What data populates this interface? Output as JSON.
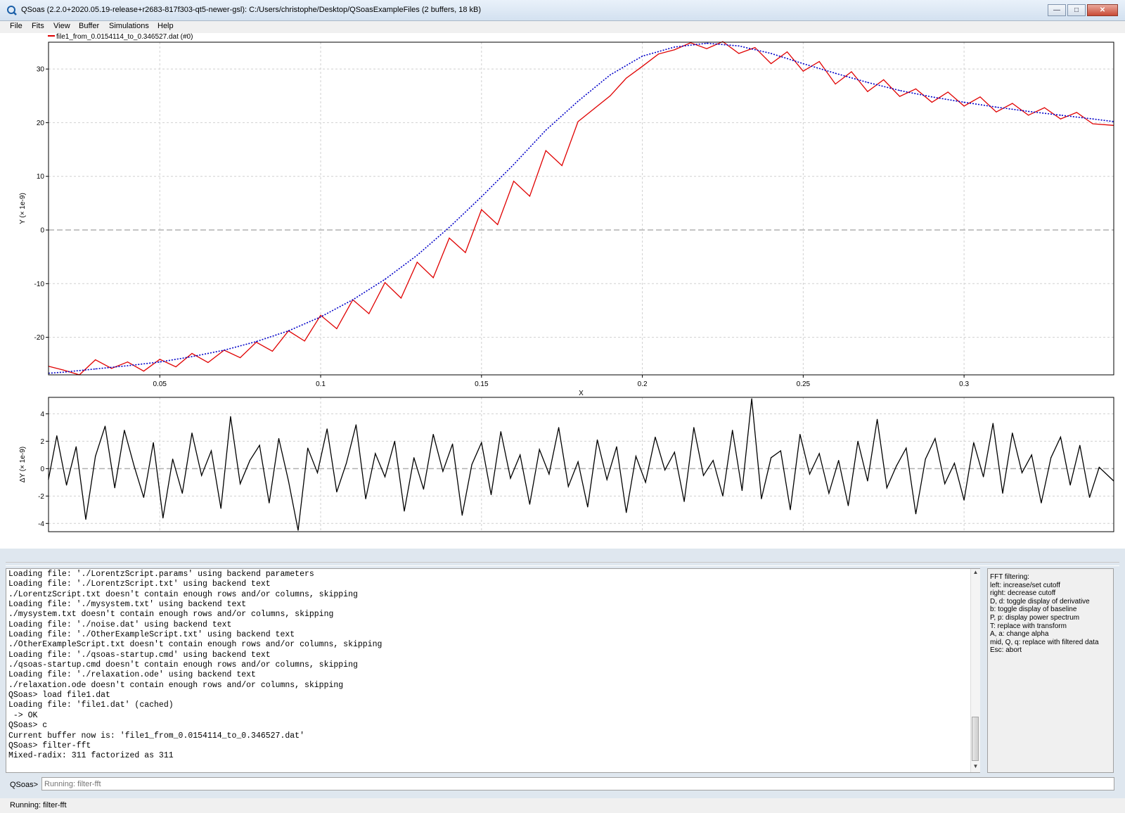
{
  "window": {
    "title": "QSoas (2.2.0+2020.05.19-release+r2683-817f303-qt5-newer-gsl): C:/Users/christophe/Desktop/QSoasExampleFiles (2 buffers, 18 kB)",
    "minimize_glyph": "—",
    "maximize_glyph": "□",
    "close_glyph": "✕"
  },
  "menu": [
    "File",
    "Fits",
    "View",
    "Buffer",
    "Simulations",
    "Help"
  ],
  "legend": {
    "label": "file1_from_0.0154114_to_0.346527.dat (#0)",
    "color": "#e00000"
  },
  "chart_data": [
    {
      "type": "line",
      "xlabel": "X",
      "ylabel": "Y (× 1e-9)",
      "xlim": [
        0.0154114,
        0.346527
      ],
      "ylim": [
        -27,
        35
      ],
      "xticks": [
        0.05,
        0.1,
        0.15,
        0.2,
        0.25,
        0.3
      ],
      "xtick_labels": [
        "0.05",
        "0.1",
        "0.15",
        "0.2",
        "0.25",
        "0.3"
      ],
      "yticks": [
        -20,
        -10,
        0,
        10,
        20,
        30
      ],
      "ytick_labels": [
        "-20",
        "-10",
        "0",
        "10",
        "20",
        "30"
      ],
      "grid": true,
      "series": [
        {
          "name": "file1_from_0.0154114_to_0.346527.dat (#0)",
          "style": "solid",
          "color": "#e00000",
          "x": [
            0.0154,
            0.02,
            0.025,
            0.03,
            0.035,
            0.04,
            0.045,
            0.05,
            0.055,
            0.06,
            0.065,
            0.07,
            0.075,
            0.08,
            0.085,
            0.09,
            0.095,
            0.1,
            0.105,
            0.11,
            0.115,
            0.12,
            0.125,
            0.13,
            0.135,
            0.14,
            0.145,
            0.15,
            0.155,
            0.16,
            0.165,
            0.17,
            0.175,
            0.18,
            0.185,
            0.19,
            0.195,
            0.2,
            0.205,
            0.21,
            0.215,
            0.22,
            0.225,
            0.23,
            0.235,
            0.24,
            0.245,
            0.25,
            0.255,
            0.26,
            0.265,
            0.27,
            0.275,
            0.28,
            0.285,
            0.29,
            0.295,
            0.3,
            0.305,
            0.31,
            0.315,
            0.32,
            0.325,
            0.33,
            0.335,
            0.34,
            0.3465
          ],
          "y": [
            -25.4,
            -26.1,
            -27.0,
            -24.2,
            -25.8,
            -24.6,
            -26.3,
            -24.1,
            -25.5,
            -23.0,
            -24.7,
            -22.4,
            -23.8,
            -20.9,
            -22.6,
            -18.8,
            -20.7,
            -15.9,
            -18.4,
            -13.0,
            -15.6,
            -9.8,
            -12.7,
            -6.0,
            -8.9,
            -1.5,
            -4.2,
            3.8,
            1.0,
            9.1,
            6.3,
            14.8,
            12.0,
            20.2,
            22.6,
            25.0,
            28.3,
            30.5,
            32.8,
            33.6,
            34.9,
            33.8,
            35.1,
            32.9,
            34.0,
            31.0,
            33.2,
            29.6,
            31.4,
            27.2,
            29.5,
            25.8,
            28.0,
            24.9,
            26.3,
            23.8,
            25.7,
            23.1,
            24.8,
            22.0,
            23.6,
            21.4,
            22.8,
            20.7,
            21.9,
            19.8,
            19.5
          ]
        },
        {
          "name": "fit",
          "style": "dotted",
          "color": "#0000c8",
          "x": [
            0.0154,
            0.02,
            0.03,
            0.04,
            0.05,
            0.06,
            0.07,
            0.08,
            0.09,
            0.1,
            0.11,
            0.12,
            0.13,
            0.14,
            0.15,
            0.16,
            0.17,
            0.18,
            0.19,
            0.2,
            0.21,
            0.22,
            0.23,
            0.24,
            0.25,
            0.26,
            0.27,
            0.28,
            0.29,
            0.3,
            0.31,
            0.32,
            0.33,
            0.34,
            0.3465
          ],
          "y": [
            -26.7,
            -26.5,
            -25.9,
            -25.3,
            -24.6,
            -23.6,
            -22.4,
            -20.8,
            -18.8,
            -16.2,
            -13.0,
            -9.2,
            -4.7,
            0.5,
            6.2,
            12.2,
            18.6,
            24.0,
            28.9,
            32.4,
            34.1,
            34.8,
            34.3,
            32.9,
            31.0,
            29.2,
            27.5,
            26.0,
            24.8,
            23.8,
            22.9,
            22.1,
            21.4,
            20.7,
            20.2
          ]
        }
      ]
    },
    {
      "type": "line",
      "xlabel": "",
      "ylabel": "ΔY (× 1e-9)",
      "xlim": [
        0.0154114,
        0.346527
      ],
      "ylim": [
        -4.6,
        5.2
      ],
      "yticks": [
        -4,
        -2,
        0,
        2,
        4
      ],
      "ytick_labels": [
        "-4",
        "-2",
        "0",
        "2",
        "4"
      ],
      "grid": true,
      "series": [
        {
          "name": "residuals",
          "style": "solid",
          "color": "#000000",
          "x": [
            0.0154,
            0.018,
            0.021,
            0.024,
            0.027,
            0.03,
            0.033,
            0.036,
            0.039,
            0.042,
            0.045,
            0.048,
            0.051,
            0.054,
            0.057,
            0.06,
            0.063,
            0.066,
            0.069,
            0.072,
            0.075,
            0.078,
            0.081,
            0.084,
            0.087,
            0.09,
            0.093,
            0.096,
            0.099,
            0.102,
            0.105,
            0.108,
            0.111,
            0.114,
            0.117,
            0.12,
            0.123,
            0.126,
            0.129,
            0.132,
            0.135,
            0.138,
            0.141,
            0.144,
            0.147,
            0.15,
            0.153,
            0.156,
            0.159,
            0.162,
            0.165,
            0.168,
            0.171,
            0.174,
            0.177,
            0.18,
            0.183,
            0.186,
            0.189,
            0.192,
            0.195,
            0.198,
            0.201,
            0.204,
            0.207,
            0.21,
            0.213,
            0.216,
            0.219,
            0.222,
            0.225,
            0.228,
            0.231,
            0.234,
            0.237,
            0.24,
            0.243,
            0.246,
            0.249,
            0.252,
            0.255,
            0.258,
            0.261,
            0.264,
            0.267,
            0.27,
            0.273,
            0.276,
            0.279,
            0.282,
            0.285,
            0.288,
            0.291,
            0.294,
            0.297,
            0.3,
            0.303,
            0.306,
            0.309,
            0.312,
            0.315,
            0.318,
            0.321,
            0.324,
            0.327,
            0.33,
            0.333,
            0.336,
            0.339,
            0.342,
            0.3465
          ],
          "y": [
            -0.8,
            2.4,
            -1.2,
            1.6,
            -3.7,
            0.9,
            3.1,
            -1.4,
            2.8,
            0.2,
            -2.1,
            1.9,
            -3.6,
            0.7,
            -1.8,
            2.6,
            -0.5,
            1.3,
            -2.9,
            3.8,
            -1.1,
            0.6,
            1.7,
            -2.5,
            2.2,
            -0.9,
            -4.5,
            1.5,
            -0.3,
            2.9,
            -1.7,
            0.4,
            3.2,
            -2.2,
            1.1,
            -0.6,
            2.0,
            -3.1,
            0.8,
            -1.5,
            2.5,
            -0.2,
            1.8,
            -3.4,
            0.3,
            1.9,
            -1.9,
            2.7,
            -0.7,
            1.0,
            -2.6,
            1.4,
            -0.4,
            3.0,
            -1.3,
            0.5,
            -2.8,
            2.1,
            -0.8,
            1.6,
            -3.2,
            0.9,
            -1.0,
            2.3,
            -0.1,
            1.2,
            -2.4,
            3.0,
            -0.5,
            0.6,
            -2.0,
            2.8,
            -1.6,
            5.1,
            -2.2,
            0.8,
            1.3,
            -3.0,
            2.5,
            -0.4,
            1.1,
            -1.8,
            0.6,
            -2.7,
            2.0,
            -0.9,
            3.6,
            -1.4,
            0.2,
            1.5,
            -3.3,
            0.7,
            2.2,
            -1.1,
            0.4,
            -2.3,
            1.9,
            -0.6,
            3.3,
            -1.8,
            2.6,
            -0.3,
            1.0,
            -2.5,
            0.8,
            2.3,
            -1.2,
            1.7,
            -2.1,
            0.1,
            -0.9
          ]
        }
      ]
    }
  ],
  "console": {
    "lines": [
      "Loading file: './LorentzScript.params' using backend parameters",
      "Loading file: './LorentzScript.txt' using backend text",
      "./LorentzScript.txt doesn't contain enough rows and/or columns, skipping",
      "Loading file: './mysystem.txt' using backend text",
      "./mysystem.txt doesn't contain enough rows and/or columns, skipping",
      "Loading file: './noise.dat' using backend text",
      "Loading file: './OtherExampleScript.txt' using backend text",
      "./OtherExampleScript.txt doesn't contain enough rows and/or columns, skipping",
      "Loading file: './qsoas-startup.cmd' using backend text",
      "./qsoas-startup.cmd doesn't contain enough rows and/or columns, skipping",
      "Loading file: './relaxation.ode' using backend text",
      "./relaxation.ode doesn't contain enough rows and/or columns, skipping",
      "QSoas> load file1.dat",
      "Loading file: 'file1.dat' (cached)",
      " -> OK",
      "QSoas> c",
      "Current buffer now is: 'file1_from_0.0154114_to_0.346527.dat'",
      "QSoas> filter-fft",
      "Mixed-radix: 311 factorized as 311"
    ]
  },
  "help_panel": {
    "lines": [
      "FFT filtering:",
      "left: increase/set cutoff",
      "right: decrease cutoff",
      "D, d: toggle display of derivative",
      "b: toggle display of baseline",
      "P, p: display power spectrum",
      "T: replace with transform",
      "A, a: change alpha",
      "mid, Q, q: replace with filtered data",
      "Esc: abort"
    ]
  },
  "prompt": {
    "label": "QSoas>",
    "placeholder": "Running: filter-fft"
  },
  "status": {
    "text": "Running: filter-fft"
  }
}
